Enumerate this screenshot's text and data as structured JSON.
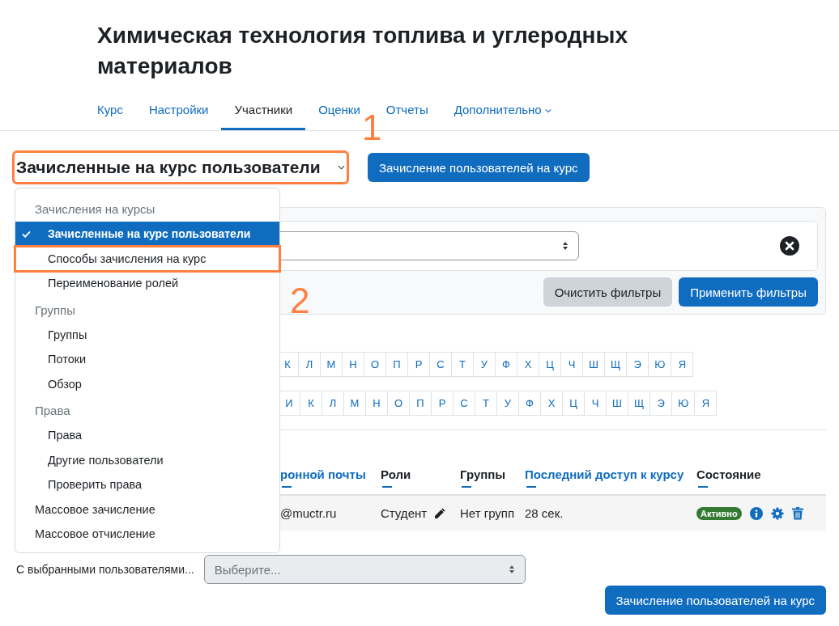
{
  "course_title": "Химическая технология топлива и углеродных материалов",
  "nav_tabs": [
    {
      "label": "Курс",
      "selected": false,
      "has_menu": false
    },
    {
      "label": "Настройки",
      "selected": false,
      "has_menu": false
    },
    {
      "label": "Участники",
      "selected": true,
      "has_menu": false
    },
    {
      "label": "Оценки",
      "selected": false,
      "has_menu": false
    },
    {
      "label": "Отчеты",
      "selected": false,
      "has_menu": false
    },
    {
      "label": "Дополнительно",
      "selected": false,
      "has_menu": true
    }
  ],
  "page_selector": {
    "label": "Зачисленные на курс пользователи",
    "expanded": true,
    "highlighted": true
  },
  "enrol_button": "Зачисление пользователей на курс",
  "filter": {
    "clear_button": "Очистить фильтры",
    "apply_button": "Применить фильтры"
  },
  "initials_rows": [
    [
      "К",
      "Л",
      "М",
      "Н",
      "О",
      "П",
      "Р",
      "С",
      "Т",
      "У",
      "Ф",
      "Х",
      "Ц",
      "Ч",
      "Ш",
      "Щ",
      "Э",
      "Ю",
      "Я"
    ],
    [
      "И",
      "К",
      "Л",
      "М",
      "Н",
      "О",
      "П",
      "Р",
      "С",
      "Т",
      "У",
      "Ф",
      "Х",
      "Ц",
      "Ч",
      "Ш",
      "Щ",
      "Э",
      "Ю",
      "Я"
    ]
  ],
  "table": {
    "columns": [
      {
        "label": "ронной почты",
        "link": true
      },
      {
        "label": "Роли",
        "link": false
      },
      {
        "label": "Группы",
        "link": false
      },
      {
        "label": "Последний доступ к курсу",
        "link": true
      },
      {
        "label": "Состояние",
        "link": false
      }
    ],
    "rows": [
      {
        "email": "@muctr.ru",
        "role": "Студент",
        "groups": "Нет групп",
        "last_access": "28 сек.",
        "status": "Активно"
      }
    ]
  },
  "bulk_action": {
    "label": "С выбранными пользователями...",
    "placeholder": "Выберите..."
  },
  "bottom_button": "Зачисление пользователей на курс",
  "menu": [
    {
      "kind": "heading",
      "label": "Зачисления на курсы"
    },
    {
      "kind": "item",
      "label": "Зачисленные на курс пользователи",
      "selected": true
    },
    {
      "kind": "item",
      "label": "Способы зачисления на курс",
      "selected": false,
      "highlighted": true
    },
    {
      "kind": "item",
      "label": "Переименование ролей",
      "selected": false
    },
    {
      "kind": "heading",
      "label": "Группы"
    },
    {
      "kind": "item",
      "label": "Группы",
      "selected": false
    },
    {
      "kind": "item",
      "label": "Потоки",
      "selected": false
    },
    {
      "kind": "item",
      "label": "Обзор",
      "selected": false
    },
    {
      "kind": "heading",
      "label": "Права"
    },
    {
      "kind": "item",
      "label": "Права",
      "selected": false
    },
    {
      "kind": "item",
      "label": "Другие пользователи",
      "selected": false
    },
    {
      "kind": "item",
      "label": "Проверить права",
      "selected": false
    },
    {
      "kind": "top",
      "label": "Массовое зачисление",
      "selected": false
    },
    {
      "kind": "top",
      "label": "Массовое отчисление",
      "selected": false
    }
  ],
  "annotations": [
    {
      "label": "1"
    },
    {
      "label": "2"
    }
  ]
}
